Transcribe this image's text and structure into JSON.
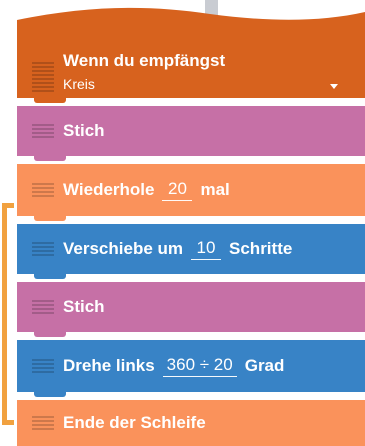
{
  "hat_block": {
    "title": "Wenn du empfängst",
    "dropdown_value": "Kreis"
  },
  "blocks": [
    {
      "label": "Stich"
    },
    {
      "label_before": "Wiederhole",
      "value": "20",
      "label_after": "mal"
    },
    {
      "label_before": "Verschiebe um",
      "value": "10",
      "label_after": "Schritte"
    },
    {
      "label": "Stich"
    },
    {
      "label_before": "Drehe links",
      "value": "360 ÷ 20",
      "label_after": "Grad"
    },
    {
      "label": "Ende der Schleife"
    }
  ],
  "colors": {
    "hat": "#d7621e",
    "stich": "#c670a6",
    "control": "#fa925b",
    "motion": "#3883c6",
    "loop_bracket": "#f1a13f"
  },
  "icons": {
    "drag_handle": "grip-lines-icon",
    "dropdown": "caret-down-icon"
  }
}
